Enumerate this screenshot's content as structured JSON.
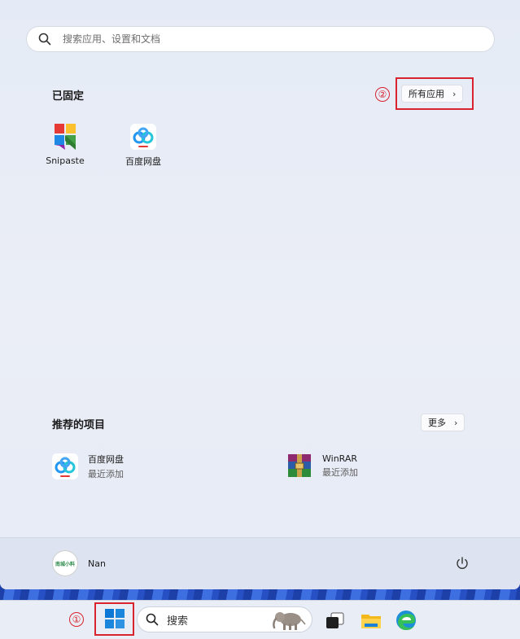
{
  "search": {
    "placeholder": "搜索应用、设置和文档"
  },
  "pinned": {
    "title": "已固定",
    "all_apps_label": "所有应用",
    "apps": [
      {
        "label": "Snipaste",
        "icon": "snipaste-icon"
      },
      {
        "label": "百度网盘",
        "icon": "baidu-netdisk-icon"
      }
    ]
  },
  "recommended": {
    "title": "推荐的项目",
    "more_label": "更多",
    "items": [
      {
        "name": "百度网盘",
        "sub": "最近添加",
        "icon": "baidu-netdisk-icon"
      },
      {
        "name": "WinRAR",
        "sub": "最近添加",
        "icon": "winrar-icon"
      }
    ]
  },
  "user": {
    "name": "Nan",
    "avatar_text": "南城小料"
  },
  "taskbar": {
    "search_label": "搜索"
  },
  "annotations": {
    "one": "①",
    "two": "②"
  },
  "colors": {
    "highlight": "#d9232e",
    "accent": "#0a78d4"
  }
}
